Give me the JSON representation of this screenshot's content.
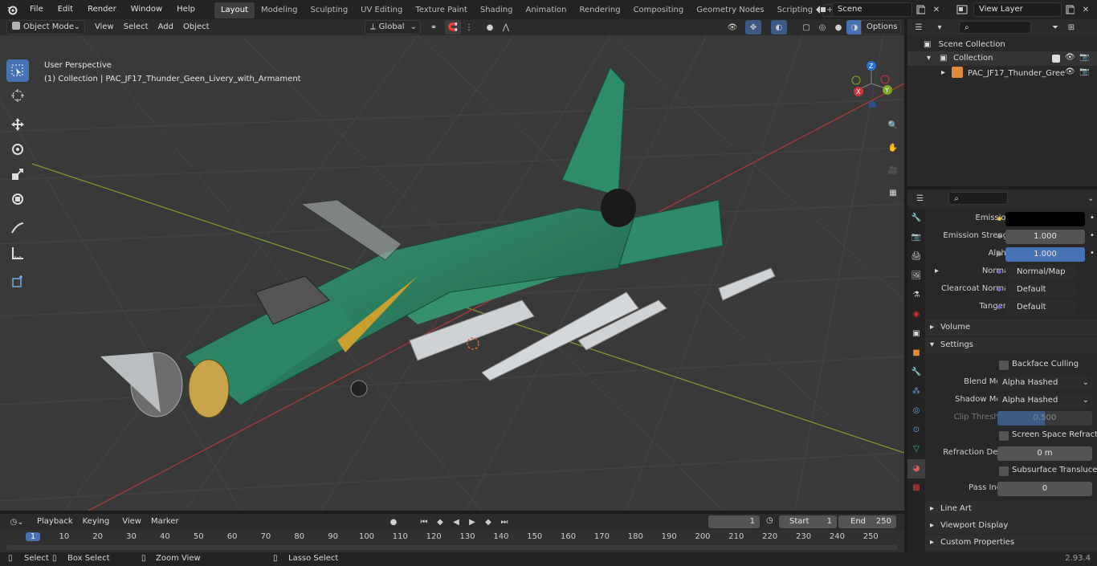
{
  "menubar": {
    "items": [
      "File",
      "Edit",
      "Render",
      "Window",
      "Help"
    ],
    "workspaces": [
      "Layout",
      "Modeling",
      "Sculpting",
      "UV Editing",
      "Texture Paint",
      "Shading",
      "Animation",
      "Rendering",
      "Compositing",
      "Geometry Nodes",
      "Scripting"
    ],
    "active_workspace": "Layout",
    "scene_value": "Scene",
    "view_layer_value": "View Layer"
  },
  "viewport_header": {
    "mode": "Object Mode",
    "menus": [
      "View",
      "Select",
      "Add",
      "Object"
    ],
    "transform_orientation": "Global",
    "options_label": "Options"
  },
  "viewport": {
    "perspective_label": "User Perspective",
    "collection_label": "(1) Collection | PAC_JF17_Thunder_Geen_Livery_with_Armament",
    "gizmo_axes": [
      "X",
      "Y",
      "Z"
    ]
  },
  "outliner": {
    "root": "Scene Collection",
    "collection": "Collection",
    "object": "PAC_JF17_Thunder_Gree"
  },
  "properties": {
    "rows": [
      {
        "label": "Emission",
        "value": "",
        "kind": "color",
        "dot": "#e5c33b"
      },
      {
        "label": "Emission Strengt",
        "value": "1.000",
        "kind": "num",
        "dot": "#9a9a9a"
      },
      {
        "label": "Alpha",
        "value": "1.000",
        "kind": "blue",
        "dot": "#9a9a9a"
      },
      {
        "label": "Normal",
        "value": "Normal/Map",
        "kind": "link",
        "dot": "#6d63c9"
      },
      {
        "label": "Clearcoat Normal",
        "value": "Default",
        "kind": "link",
        "dot": "#6d63c9"
      },
      {
        "label": "Tangent",
        "value": "Default",
        "kind": "link",
        "dot": "#6d63c9"
      }
    ],
    "section_volume": "Volume",
    "section_settings": "Settings",
    "backface_culling": "Backface Culling",
    "blend_mode_label": "Blend Mode",
    "blend_mode_value": "Alpha Hashed",
    "shadow_mode_label": "Shadow Mode",
    "shadow_mode_value": "Alpha Hashed",
    "clip_threshold_label": "Clip Threshold",
    "clip_threshold_value": "0.500",
    "screen_space_refraction": "Screen Space Refraction",
    "refraction_depth_label": "Refraction Depth",
    "refraction_depth_value": "0 m",
    "subsurface_translucency": "Subsurface Translucency",
    "pass_index_label": "Pass Index",
    "pass_index_value": "0",
    "section_line_art": "Line Art",
    "section_viewport_display": "Viewport Display",
    "section_custom_properties": "Custom Properties"
  },
  "timeline": {
    "menus": [
      "Playback",
      "Keying",
      "View",
      "Marker"
    ],
    "current_frame": "1",
    "start_label": "Start",
    "start_value": "1",
    "end_label": "End",
    "end_value": "250",
    "ticks": [
      "1",
      "10",
      "20",
      "30",
      "40",
      "50",
      "60",
      "70",
      "80",
      "90",
      "100",
      "110",
      "120",
      "130",
      "140",
      "150",
      "160",
      "170",
      "180",
      "190",
      "200",
      "210",
      "220",
      "230",
      "240",
      "250"
    ]
  },
  "statusbar": {
    "select": "Select",
    "box_select": "Box Select",
    "zoom_view": "Zoom View",
    "lasso_select": "Lasso Select",
    "version": "2.93.4"
  },
  "colors": {
    "accent_blue": "#4772b3",
    "active_frame": "#4772b3",
    "aircraft_green": "#2e8a68",
    "axis_red": "#a83a3a",
    "axis_green": "#7a9a2c"
  }
}
